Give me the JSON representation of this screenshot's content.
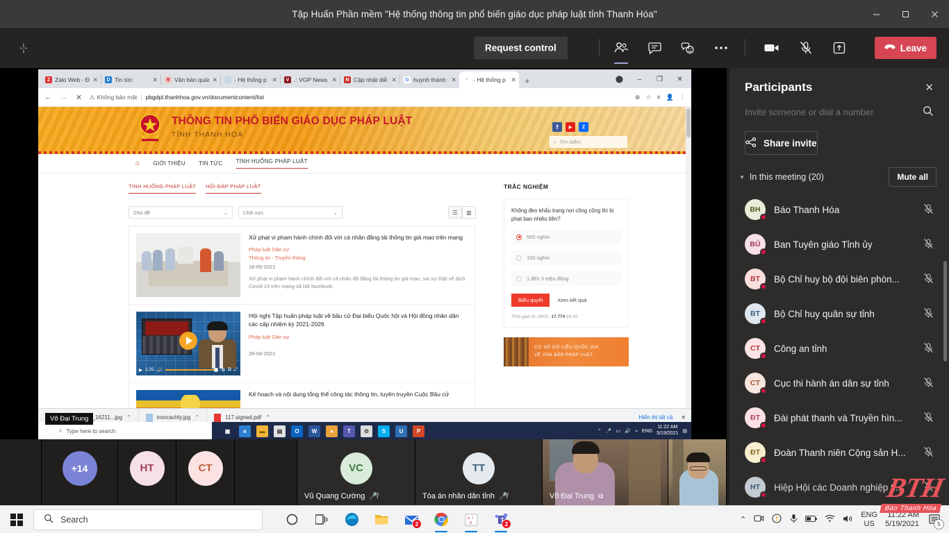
{
  "teams": {
    "window_title": "Tập Huấn Phần mềm \"Hệ thống thông tin phổ biến giáo dục pháp luật tỉnh Thanh Hóa\"",
    "minimize_label": "–",
    "restore_label": "❐",
    "close_label": "✕",
    "actionbar": {
      "request_control": "Request control",
      "people_icon": "people-icon",
      "chat_icon": "chat-icon",
      "reactions_icon": "reactions-icon",
      "more_icon": "more-options-icon",
      "camera_icon": "camera-icon",
      "mic_icon": "mic-muted-icon",
      "share_icon": "share-tray-icon",
      "leave_label": "Leave"
    }
  },
  "participants_panel": {
    "title": "Participants",
    "close_icon": "close-icon",
    "invite_placeholder": "Invite someone or dial a number",
    "search_icon": "search-icon",
    "share_invite_label": "Share invite",
    "share_icon": "share-icon",
    "section_label": "In this meeting (20)",
    "mute_all_label": "Mute all",
    "people": [
      {
        "initials": "BH",
        "name": "Báo Thanh Hóa",
        "av_bg": "#e9ecd8",
        "av_fg": "#4a5c1e",
        "muted": true
      },
      {
        "initials": "BỦ",
        "name": "Ban Tuyên giáo Tỉnh ủy",
        "av_bg": "#f7dfe6",
        "av_fg": "#a0415c",
        "muted": true
      },
      {
        "initials": "BT",
        "name": "Bộ Chỉ huy bộ đội biên phòn...",
        "av_bg": "#f9dede",
        "av_fg": "#b03a3a",
        "muted": true
      },
      {
        "initials": "BT",
        "name": "Bộ Chỉ huy quân sự tỉnh",
        "av_bg": "#dfe6ee",
        "av_fg": "#3a5f85",
        "muted": true
      },
      {
        "initials": "CT",
        "name": "Công an tỉnh",
        "av_bg": "#fbe3e3",
        "av_fg": "#b03a3a",
        "muted": true
      },
      {
        "initials": "CT",
        "name": "Cục thi hành án dân sự tỉnh",
        "av_bg": "#f7e6df",
        "av_fg": "#a5552f",
        "muted": true
      },
      {
        "initials": "ĐT",
        "name": "Đài phát thanh và Truyền hìn...",
        "av_bg": "#fbe1e5",
        "av_fg": "#b0456a",
        "muted": true
      },
      {
        "initials": "ĐT",
        "name": "Đoàn Thanh niên Cộng sản H...",
        "av_bg": "#f7edcf",
        "av_fg": "#8a6a1e",
        "muted": true
      },
      {
        "initials": "HT",
        "name": "Hiệp Hội các Doanh nghiệp tỉ...",
        "av_bg": "#dfe6ee",
        "av_fg": "#3a5f85",
        "muted": true
      }
    ]
  },
  "filmstrip": {
    "overflow_label": "+14",
    "tiles": [
      {
        "type": "avatar",
        "initials": "+14",
        "name": "",
        "av_bg": "#7b83d6",
        "av_fg": "#ffffff",
        "muted": false
      },
      {
        "type": "avatar",
        "initials": "HT",
        "name": "",
        "av_bg": "#f7dfe6",
        "av_fg": "#a0415c",
        "muted": false
      },
      {
        "type": "avatar",
        "initials": "CT",
        "name": "",
        "av_bg": "#fbe3e3",
        "av_fg": "#c05c3a",
        "muted": false
      },
      {
        "type": "avatar",
        "initials": "VC",
        "name": "Vũ Quang Cường",
        "av_bg": "#d9ecd9",
        "av_fg": "#3f7a3f",
        "muted": true
      },
      {
        "type": "avatar",
        "initials": "TT",
        "name": "Tòa án nhân dân tỉnh",
        "av_bg": "#e4eaee",
        "av_fg": "#3d6478",
        "muted": true
      },
      {
        "type": "video",
        "initials": "",
        "name": "Võ Đại Trung",
        "av_bg": "",
        "av_fg": "",
        "muted": false
      },
      {
        "type": "video",
        "initials": "",
        "name": "",
        "av_bg": "",
        "av_fg": "",
        "muted": false
      }
    ]
  },
  "shared_screen": {
    "name_pill": "Võ Đại Trung",
    "browser": {
      "tabs": [
        {
          "label": "Zalo Web - Đ",
          "fav_bg": "#e03131",
          "fav_text": "Z"
        },
        {
          "label": "Tin tức",
          "fav_bg": "#1c7ed6",
          "fav_text": "D"
        },
        {
          "label": "Văn bản quản",
          "fav_bg": "#f0b1b1",
          "fav_text": "✶"
        },
        {
          "label": "- Hệ thống p",
          "fav_bg": "#c9d6e8",
          "fav_text": ""
        },
        {
          "label": ".: VGP News",
          "fav_bg": "#8b1a1a",
          "fav_text": "V"
        },
        {
          "label": "Cập nhật diễ",
          "fav_bg": "#d12f2f",
          "fav_text": "N"
        },
        {
          "label": "huỳnh thành",
          "fav_bg": "#ffffff",
          "fav_text": "G"
        },
        {
          "label": "- Hệ thống p",
          "fav_bg": "#dddddd",
          "fav_text": ""
        }
      ],
      "active_tab_index": 7,
      "new_tab_icon": "new-tab-icon",
      "back_icon": "back-arrow-icon",
      "forward_icon": "forward-arrow-icon",
      "stop_icon": "stop-loading-icon",
      "security_label": "Không bảo mật",
      "url": "pbgdpl.thanhhoa.gov.vn/documentcontent/list",
      "zoom_icon": "zoom-icon",
      "bookmark_icon": "bookmark-star-icon",
      "readinglist_icon": "reading-list-icon",
      "profile_icon": "profile-avatar-icon",
      "menu_icon": "chrome-menu-icon",
      "win_min": "–",
      "win_max": "❐",
      "win_close": "✕"
    },
    "site": {
      "title_line1": "THÔNG TIN PHỔ BIẾN GIÁO DỤC PHÁP LUẬT",
      "title_line2": "TỈNH THANH HÓA",
      "emblem_icon": "vietnam-emblem-icon",
      "socials": [
        {
          "name": "facebook-icon",
          "glyph": "f",
          "color": "#3b5998"
        },
        {
          "name": "youtube-icon",
          "glyph": "▶",
          "color": "#e62117"
        },
        {
          "name": "zalo-icon",
          "glyph": "Z",
          "color": "#0068ff"
        }
      ],
      "search_placeholder": "Tìm kiếm",
      "nav": [
        {
          "label": "GIỚI THIỆU",
          "selected": false
        },
        {
          "label": "TIN TỨC",
          "selected": false
        },
        {
          "label": "TÌNH HUỐNG PHÁP LUẬT",
          "selected": true
        }
      ],
      "subtabs": [
        {
          "label": "TÌNH HUỐNG PHÁP LUẬT"
        },
        {
          "label": "HỎI ĐÁP PHÁP LUẬT"
        }
      ],
      "filters": [
        {
          "label": "Chủ đề"
        },
        {
          "label": "Lĩnh vực"
        }
      ],
      "view_list_icon": "list-view-icon",
      "view_grid_icon": "grid-view-icon",
      "articles": [
        {
          "title": "Xử phạt vi phạm hành chính đối với cá nhân đăng tải thông tin giả mạo trên mạng",
          "category1": "Pháp luật Dân sự",
          "category2": "Thông tin - Truyền thông",
          "date": "18-05-2021",
          "desc": "Xử phạt vi phạm hành chính đối với cá nhân đã đăng tải thông tin giả mạo, sai sự thật về dịch Covid-19 trên mạng xã hội facebook.",
          "thumb": "office-photo"
        },
        {
          "title": "Hội nghị Tập huấn pháp luật về bầu cử Đại biểu Quốc hội và Hội đồng nhân dân các cấp nhiệm kỳ 2021-2026",
          "category1": "Pháp luật Dân sự",
          "category2": "",
          "date": "28-04-2021",
          "desc": "",
          "thumb": "video",
          "video_time": "1:25"
        },
        {
          "title": "Kế hoạch và nội dung tổng thể công tác thông tin, tuyên truyền Cuộc Bầu cử",
          "category1": "",
          "category2": "",
          "date": "",
          "desc": "",
          "thumb": "flag"
        }
      ],
      "poll": {
        "heading": "TRẮC NGHIỆM",
        "question": "Không đeo khẩu trang nơi công cộng thì bị phạt bao nhiêu tiền?",
        "options": [
          {
            "label": "500 nghìn",
            "selected": true
          },
          {
            "label": "100 nghìn",
            "selected": false
          },
          {
            "label": "1 đến 3 triệu đồng",
            "selected": false
          }
        ],
        "vote_label": "Biểu quyết",
        "results_label": "Xem kết quả",
        "meta_prefix": "Thời gian từ 26/01-",
        "meta_count": "17.774",
        "meta_suffix": "trả lời"
      },
      "banner": {
        "line1": "CƠ SỞ DỮ LIỆU QUỐC GIA",
        "line2": "VỀ VĂN BẢN PHÁP LUẬT"
      }
    },
    "downloads": {
      "items": [
        {
          "name": "A1_DN_165_16211...jpg",
          "type": "image"
        },
        {
          "name": "troncachly.jpg",
          "type": "image"
        },
        {
          "name": "117.signed.pdf",
          "type": "pdf"
        }
      ],
      "show_all_label": "Hiển thị tất cả",
      "close_icon": "close-icon"
    },
    "inner_taskbar": {
      "search_placeholder": "Type here to search",
      "apps": [
        {
          "name": "task-view-icon",
          "glyph": "▣",
          "color": "#ffffff"
        },
        {
          "name": "edge-icon",
          "glyph": "e",
          "color": "#2f7fd1"
        },
        {
          "name": "file-explorer-icon",
          "glyph": "▬",
          "color": "#f2b53a"
        },
        {
          "name": "store-icon",
          "glyph": "▤",
          "color": "#dadada"
        },
        {
          "name": "outlook-icon",
          "glyph": "O",
          "color": "#0a66c2"
        },
        {
          "name": "word-icon",
          "glyph": "W",
          "color": "#2b579a"
        },
        {
          "name": "chrome-icon",
          "glyph": "●",
          "color": "#e9a33b"
        },
        {
          "name": "teams-icon",
          "glyph": "T",
          "color": "#5558af"
        },
        {
          "name": "settings-icon",
          "glyph": "⚙",
          "color": "#dddddd"
        },
        {
          "name": "skype-icon",
          "glyph": "S",
          "color": "#00aff0"
        },
        {
          "name": "unikey-icon",
          "glyph": "U",
          "color": "#2f6fb5"
        },
        {
          "name": "powerpoint-icon",
          "glyph": "P",
          "color": "#d24726"
        }
      ],
      "lang": "ENG",
      "time": "11:22 AM",
      "date": "5/19/2021"
    }
  },
  "watermark": {
    "big": "BTH",
    "small": "Báo Thanh Hóa"
  },
  "taskbar": {
    "start_icon": "windows-start-icon",
    "search_placeholder": "Search",
    "search_icon": "search-icon",
    "apps": [
      {
        "name": "cortana-icon",
        "glyph": "◯",
        "color": "#333333",
        "badge": "",
        "active": false
      },
      {
        "name": "task-view-icon",
        "glyph": "❐",
        "color": "#333333",
        "badge": "",
        "active": false
      },
      {
        "name": "edge-icon",
        "glyph": "e",
        "color": "#2f87c8",
        "badge": "",
        "active": false
      },
      {
        "name": "file-explorer-icon",
        "glyph": "▬",
        "color": "#f0b429",
        "badge": "",
        "active": false
      },
      {
        "name": "mail-icon",
        "glyph": "✉",
        "color": "#1a73c8",
        "badge": "2",
        "active": false
      },
      {
        "name": "chrome-icon",
        "glyph": "●",
        "color": "#e9a33b",
        "badge": "",
        "active": true
      },
      {
        "name": "unikey-icon",
        "glyph": "U",
        "color": "#c0392b",
        "badge": "",
        "active": true
      },
      {
        "name": "teams-icon",
        "glyph": "T",
        "color": "#5558af",
        "badge": "2",
        "active": true
      }
    ],
    "tray": {
      "chevron_icon": "show-hidden-icons-icon",
      "camera_icon": "camera-icon",
      "warning_icon": "warning-icon",
      "mic_icon": "mic-icon",
      "battery_icon": "battery-icon",
      "wifi_icon": "wifi-icon",
      "volume_icon": "volume-icon",
      "lang_line1": "ENG",
      "lang_line2": "US",
      "time": "11:22 AM",
      "date": "5/19/2021",
      "notif_icon": "notifications-icon",
      "notif_count": "5"
    }
  },
  "colors": {
    "teams_bg": "#201f1e",
    "panel_bg": "#2d2c2b",
    "leave_red": "#d74654",
    "site_orange": "#f7a81b",
    "site_red": "#c4172b",
    "accent_purple": "#a6a7dc"
  }
}
